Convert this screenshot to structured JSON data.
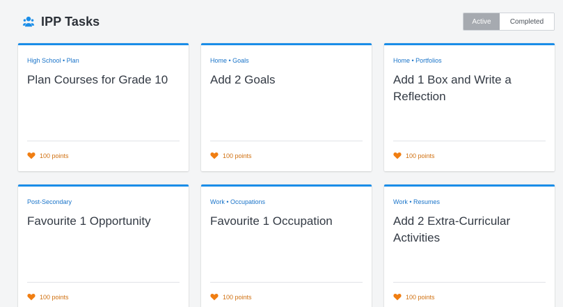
{
  "header": {
    "title": "IPP Tasks",
    "icon": "user-group-icon",
    "accent_color": "#1a8de8"
  },
  "toggle": {
    "active_label": "Active",
    "completed_label": "Completed",
    "selected": "Active"
  },
  "cards": [
    {
      "breadcrumb": "High School • Plan",
      "title": "Plan Courses for Grade 10",
      "points": "100 points"
    },
    {
      "breadcrumb": "Home • Goals",
      "title": "Add 2 Goals",
      "points": "100 points"
    },
    {
      "breadcrumb": "Home • Portfolios",
      "title": "Add 1 Box and Write a Reflection",
      "points": "100 points"
    },
    {
      "breadcrumb": "Post-Secondary",
      "title": "Favourite 1 Opportunity",
      "points": "100 points"
    },
    {
      "breadcrumb": "Work • Occupations",
      "title": "Favourite 1 Occupation",
      "points": "100 points"
    },
    {
      "breadcrumb": "Work • Resumes",
      "title": "Add 2 Extra-Curricular Activities",
      "points": "100 points"
    }
  ],
  "colors": {
    "card_top_border": "#1a8de8",
    "breadcrumb": "#1a74c9",
    "points": "#d07010",
    "heart": "#f07e12",
    "toggle_active_bg": "#a6aab0"
  }
}
